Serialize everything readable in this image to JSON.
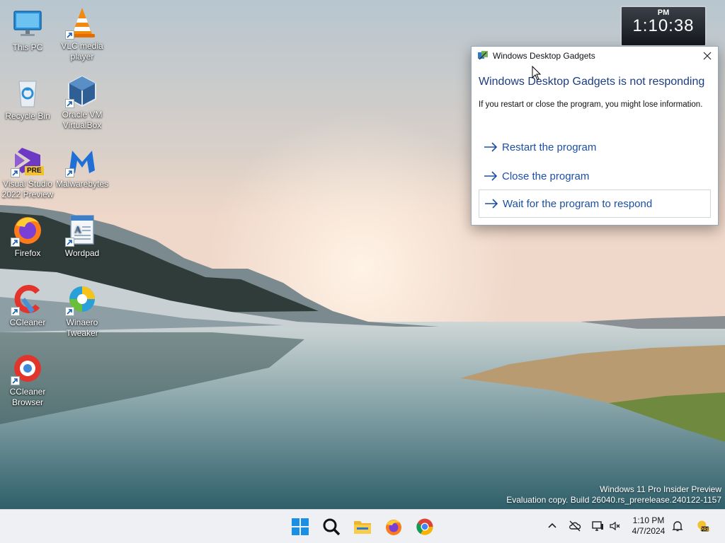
{
  "desktop": {
    "icons": [
      {
        "label": "This PC"
      },
      {
        "label": "VLC media player"
      },
      {
        "label": "Recycle Bin"
      },
      {
        "label": "Oracle VM VirtualBox"
      },
      {
        "label": "Visual Studio 2022 Preview"
      },
      {
        "label": "Malwarebytes"
      },
      {
        "label": "Firefox"
      },
      {
        "label": "Wordpad"
      },
      {
        "label": "CCleaner"
      },
      {
        "label": "Winaero Tweaker"
      },
      {
        "label": "CCleaner Browser"
      }
    ],
    "vs_badge": "PRE"
  },
  "clock_gadget": {
    "ampm": "PM",
    "time": "1:10:38"
  },
  "dialog": {
    "title": "Windows Desktop Gadgets",
    "heading": "Windows Desktop Gadgets is not responding",
    "message": "If you restart or close the program, you might lose information.",
    "options": [
      {
        "label": "Restart the program"
      },
      {
        "label": "Close the program"
      },
      {
        "label": "Wait for the program to respond"
      }
    ],
    "accent": "#1b4fa8"
  },
  "watermark": {
    "line1": "Windows 11 Pro Insider Preview",
    "line2": "Evaluation copy. Build 26040.rs_prerelease.240122-1157"
  },
  "taskbar": {
    "apps": [
      "start-icon",
      "search-icon",
      "file-explorer-icon",
      "firefox-icon",
      "chrome-icon"
    ],
    "tray": {
      "time": "1:10 PM",
      "date": "4/7/2024",
      "badge": "PRE"
    }
  }
}
